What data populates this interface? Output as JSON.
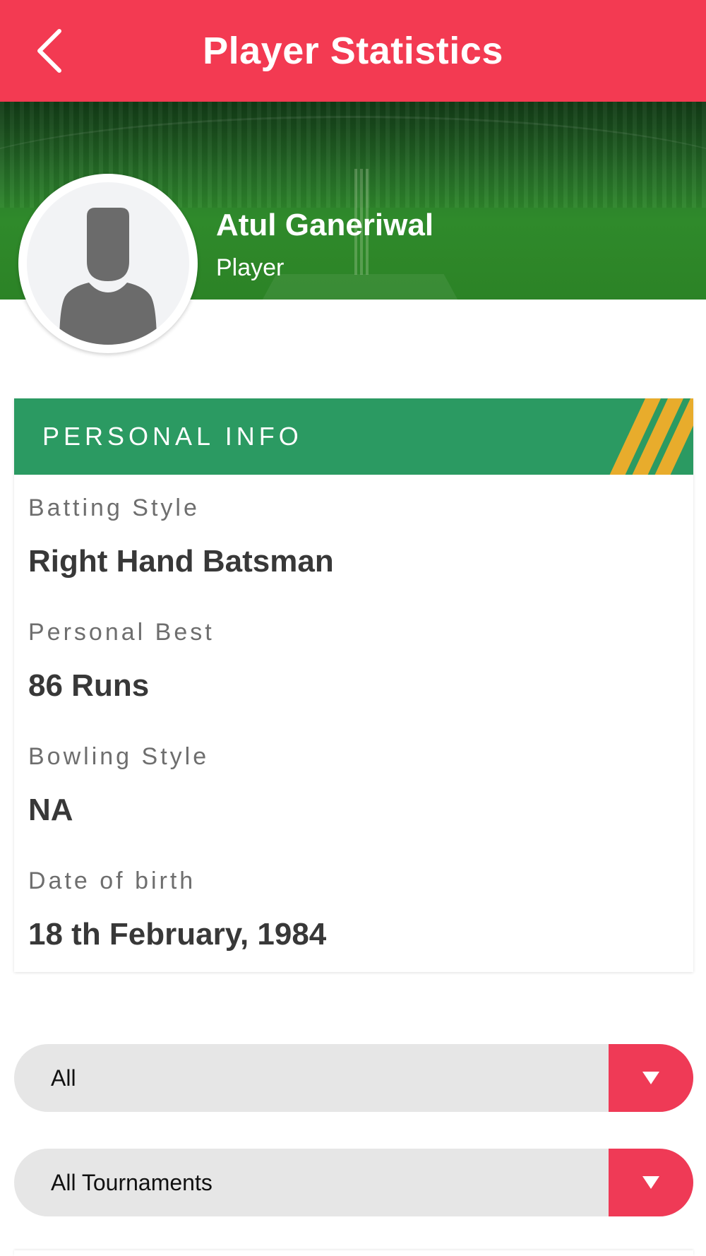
{
  "header": {
    "title": "Player Statistics"
  },
  "profile": {
    "name": "Atul Ganeriwal",
    "role": "Player"
  },
  "personal_info": {
    "title": "PERSONAL INFO",
    "fields": [
      {
        "label": "Batting Style",
        "value": "Right Hand Batsman"
      },
      {
        "label": "Personal Best",
        "value": "86 Runs"
      },
      {
        "label": "Bowling Style",
        "value": "NA"
      },
      {
        "label": "Date of birth",
        "value": "18 th February, 1984"
      }
    ]
  },
  "filters": [
    {
      "selected": "All"
    },
    {
      "selected": "All Tournaments"
    }
  ],
  "colors": {
    "app_bar": "#f33a52",
    "section_header": "#2b9a62",
    "stripe_accent": "#e8ac2c",
    "dropdown_button": "#ef3a56"
  },
  "icons": {
    "back": "chevron-left-icon",
    "avatar": "person-silhouette-icon",
    "dropdown": "triangle-down-icon"
  }
}
